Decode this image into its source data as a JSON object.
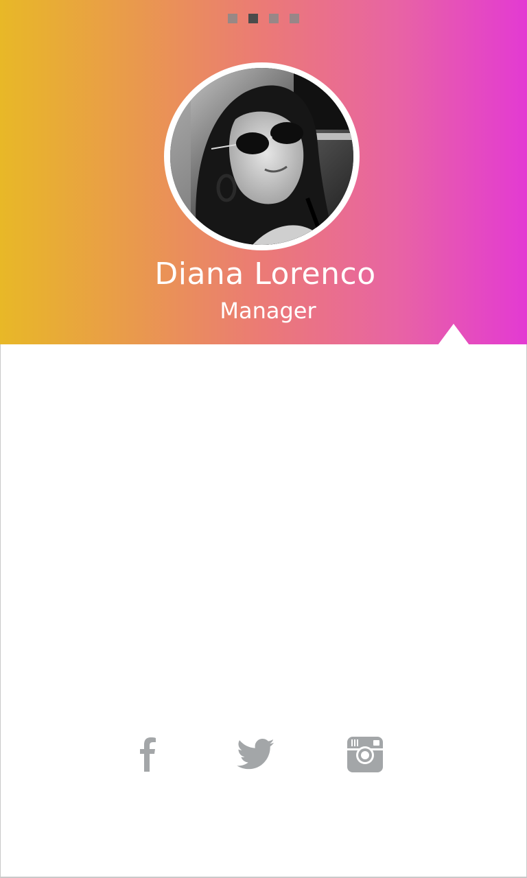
{
  "pager": {
    "dots": [
      {
        "active": false
      },
      {
        "active": true
      },
      {
        "active": false
      },
      {
        "active": false
      }
    ]
  },
  "profile": {
    "name": "Diana Lorenco",
    "role": "Manager"
  },
  "social": {
    "icons": [
      "facebook-icon",
      "twitter-icon",
      "instagram-icon"
    ],
    "icon_color": "#a3a6a8"
  },
  "colors": {
    "gradient_start": "#e8b827",
    "gradient_end": "#e33ad3",
    "pager_dot": "#8a8a8a",
    "pager_dot_active": "#4b4b4b"
  }
}
